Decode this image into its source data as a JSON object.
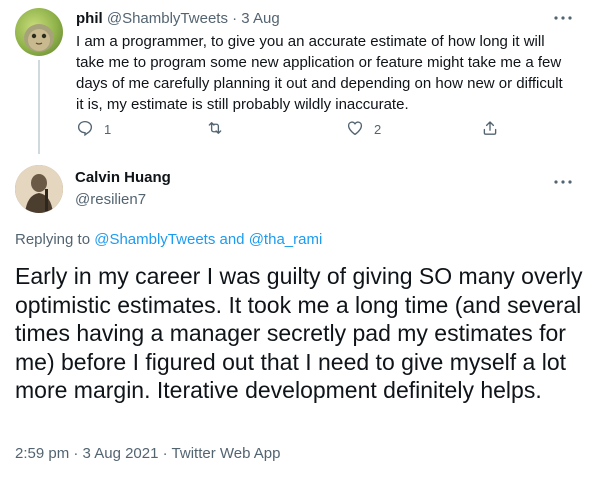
{
  "parent_tweet": {
    "display_name": "phil",
    "handle": "@ShamblyTweets",
    "separator": "·",
    "date": "3 Aug",
    "text": "I am a programmer,  to give you an accurate estimate of how long it will take me to program some new application or feature might take me a few days of me carefully planning it out and depending on how new or difficult it is, my estimate is still probably wildly inaccurate.",
    "reply_count": "1",
    "like_count": "2",
    "avatar_colors": [
      "#c9dd7a",
      "#8fb24a"
    ]
  },
  "main_tweet": {
    "display_name": "Calvin Huang",
    "handle": "@resilien7",
    "replying_prefix": "Replying to",
    "replying_user1": "@ShamblyTweets",
    "replying_and": "and",
    "replying_user2": "@tha_rami",
    "text": "Early in my career I was guilty of giving SO many overly optimistic estimates. It took me a long time (and several times having a manager secretly pad my estimates for me) before I figured out that I need to give myself a lot more margin. Iterative development definitely helps.",
    "time": "2:59 pm",
    "separator": "·",
    "date": "3 Aug 2021",
    "source": "Twitter Web App"
  },
  "icons": {
    "more": "more-horizontal-icon",
    "reply": "reply-icon",
    "retweet": "retweet-icon",
    "like": "heart-icon",
    "share": "share-icon"
  },
  "colors": {
    "text": "#0f1419",
    "muted": "#536471",
    "link": "#1d9bf0",
    "thread_line": "#cfd9de"
  }
}
